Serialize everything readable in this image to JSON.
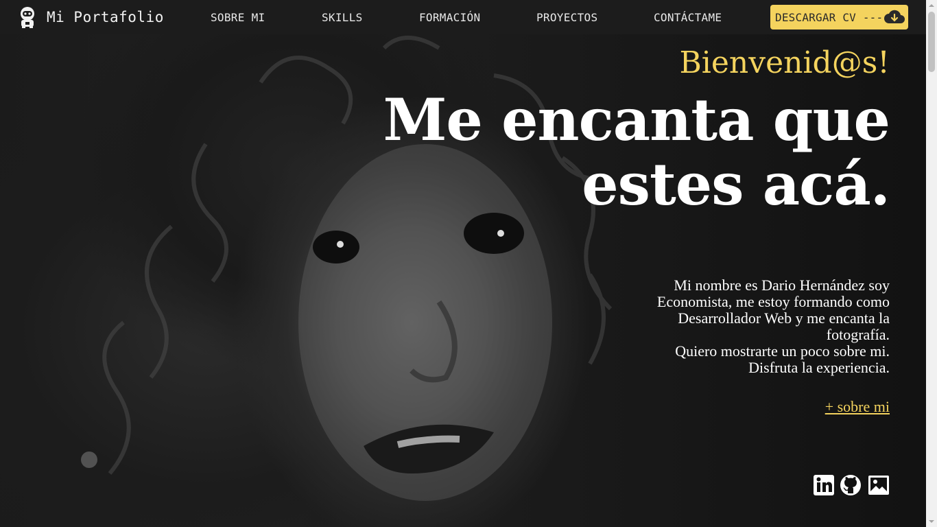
{
  "brand": {
    "name": "Mi Portafolio",
    "icon": "astronaut-icon"
  },
  "nav": {
    "items": [
      {
        "label": "SOBRE MI"
      },
      {
        "label": "SKILLS"
      },
      {
        "label": "FORMACIÓN"
      },
      {
        "label": "PROYECTOS"
      },
      {
        "label": "CONTÁCTAME"
      }
    ],
    "cv_button": {
      "label": "DESCARGAR CV ---",
      "icon": "cloud-download-icon"
    }
  },
  "hero": {
    "welcome": "Bienvenid@s!",
    "headline": "Me encanta que estes acá.",
    "intro_lines": [
      "Mi nombre es Dario Hernández soy Economista, me estoy formando como Desarrollador Web y me encanta la fotografía.",
      "Quiero mostrarte un poco sobre mi.",
      "Disfruta la experiencia."
    ],
    "more_link": "+ sobre mi"
  },
  "social": [
    {
      "icon": "linkedin-icon"
    },
    {
      "icon": "github-icon"
    },
    {
      "icon": "image-icon"
    }
  ],
  "colors": {
    "accent": "#f4d35e",
    "nav_bg": "#1c1c1c",
    "text": "#ffffff"
  }
}
